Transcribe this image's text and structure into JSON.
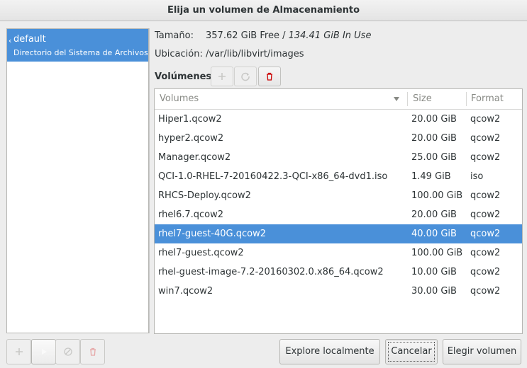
{
  "window": {
    "title": "Elija un volumen de Almacenamiento"
  },
  "pools": [
    {
      "name": "default",
      "type": "Directorio del Sistema de Archivos",
      "selected": true
    }
  ],
  "details": {
    "size_label": "Tamaño:",
    "free": "357.62 GiB Free",
    "separator": " / ",
    "in_use": "134.41 GiB In Use",
    "location_label": "Ubicación:",
    "location": "/var/lib/libvirt/images",
    "volumes_label": "Volúmenes"
  },
  "volume_toolbar": [
    {
      "icon": "add-icon",
      "enabled": false
    },
    {
      "icon": "refresh-icon",
      "enabled": false
    },
    {
      "icon": "delete-icon",
      "enabled": true,
      "color": "#cc0000"
    }
  ],
  "table": {
    "columns": [
      "Volumes",
      "Size",
      "Format"
    ],
    "rows": [
      {
        "name": "Hiper1.qcow2",
        "size": "20.00 GiB",
        "format": "qcow2"
      },
      {
        "name": "hyper2.qcow2",
        "size": "20.00 GiB",
        "format": "qcow2"
      },
      {
        "name": "Manager.qcow2",
        "size": "25.00 GiB",
        "format": "qcow2"
      },
      {
        "name": "QCI-1.0-RHEL-7-20160422.3-QCI-x86_64-dvd1.iso",
        "size": "1.49 GiB",
        "format": "iso"
      },
      {
        "name": "RHCS-Deploy.qcow2",
        "size": "100.00 GiB",
        "format": "qcow2"
      },
      {
        "name": "rhel6.7.qcow2",
        "size": "20.00 GiB",
        "format": "qcow2"
      },
      {
        "name": "rhel7-guest-40G.qcow2",
        "size": "40.00 GiB",
        "format": "qcow2",
        "selected": true
      },
      {
        "name": "rhel7-guest.qcow2",
        "size": "100.00 GiB",
        "format": "qcow2"
      },
      {
        "name": "rhel-guest-image-7.2-20160302.0.x86_64.qcow2",
        "size": "10.00 GiB",
        "format": "qcow2"
      },
      {
        "name": "win7.qcow2",
        "size": "30.00 GiB",
        "format": "qcow2"
      }
    ]
  },
  "pool_toolbar": [
    {
      "icon": "add-icon",
      "enabled": false
    },
    {
      "icon": "play-icon",
      "enabled": true
    },
    {
      "icon": "stop-icon",
      "enabled": false
    },
    {
      "icon": "delete-icon",
      "enabled": false
    }
  ],
  "buttons": {
    "browse_local": "Explore localmente",
    "cancel": "Cancelar",
    "choose": "Elegir volumen"
  },
  "colors": {
    "selection": "#4a90d9",
    "delete": "#cc0000"
  }
}
